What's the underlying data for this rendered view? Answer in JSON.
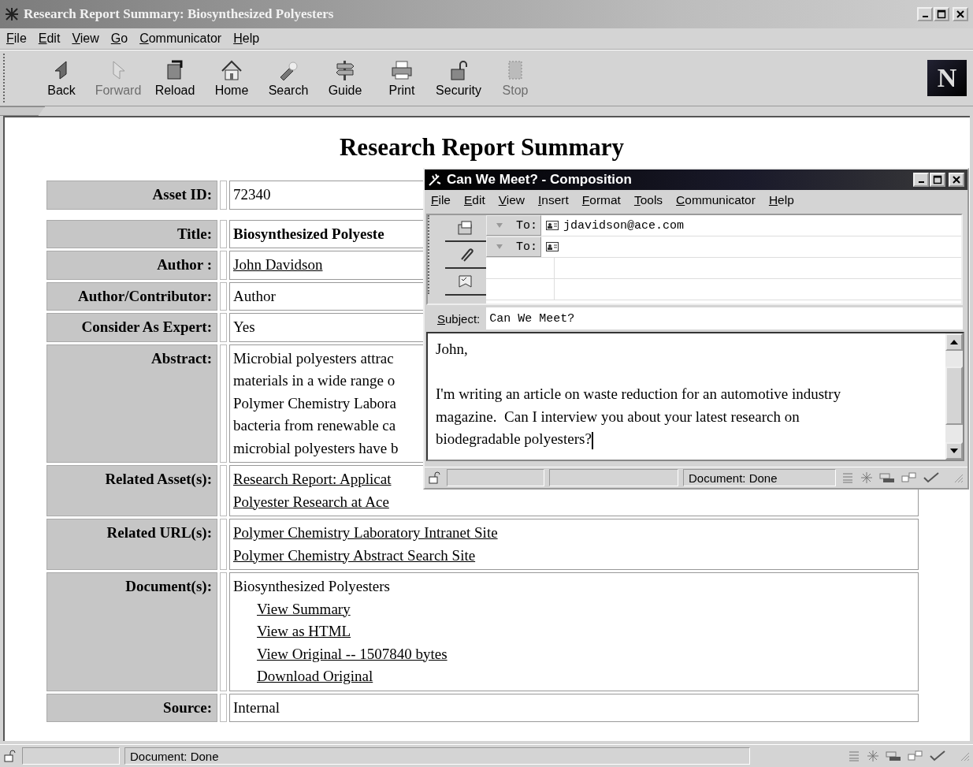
{
  "window": {
    "title": "Research Report Summary: Biosynthesized Polyesters"
  },
  "menu": [
    "File",
    "Edit",
    "View",
    "Go",
    "Communicator",
    "Help"
  ],
  "toolbar": [
    {
      "label": "Back",
      "disabled": false
    },
    {
      "label": "Forward",
      "disabled": true
    },
    {
      "label": "Reload",
      "disabled": false
    },
    {
      "label": "Home",
      "disabled": false
    },
    {
      "label": "Search",
      "disabled": false
    },
    {
      "label": "Guide",
      "disabled": false
    },
    {
      "label": "Print",
      "disabled": false
    },
    {
      "label": "Security",
      "disabled": false
    },
    {
      "label": "Stop",
      "disabled": true
    }
  ],
  "logo": "N",
  "page_title": "Research Report Summary",
  "fields": [
    {
      "label": "Asset ID:",
      "values": [
        {
          "kind": "text",
          "text": "72340"
        }
      ]
    },
    {
      "label": "Title:",
      "values": [
        {
          "kind": "bold",
          "text": "Biosynthesized Polyeste"
        }
      ]
    },
    {
      "label": "Author :",
      "values": [
        {
          "kind": "link",
          "text": "John Davidson"
        }
      ]
    },
    {
      "label": "Author/Contributor:",
      "values": [
        {
          "kind": "text",
          "text": "Author"
        }
      ]
    },
    {
      "label": "Consider As Expert:",
      "values": [
        {
          "kind": "text",
          "text": "Yes"
        }
      ]
    },
    {
      "label": "Abstract:",
      "values": [
        {
          "kind": "text",
          "text": "Microbial polyesters attrac"
        },
        {
          "kind": "text",
          "text": "materials in a wide range o"
        },
        {
          "kind": "text",
          "text": "Polymer Chemistry Labora"
        },
        {
          "kind": "text",
          "text": "bacteria from renewable ca"
        },
        {
          "kind": "text",
          "text": "microbial polyesters have b"
        }
      ]
    },
    {
      "label": "Related Asset(s):",
      "values": [
        {
          "kind": "link",
          "text": "Research Report: Applicat"
        },
        {
          "kind": "link",
          "text": "Polyester Research at Ace"
        }
      ]
    },
    {
      "label": "Related URL(s):",
      "values": [
        {
          "kind": "link",
          "text": "Polymer Chemistry Laboratory Intranet Site"
        },
        {
          "kind": "link",
          "text": "Polymer Chemistry Abstract Search Site"
        }
      ]
    },
    {
      "label": "Document(s):",
      "values": [
        {
          "kind": "text",
          "text": "Biosynthesized Polyesters"
        },
        {
          "kind": "sublink",
          "text": "View Summary"
        },
        {
          "kind": "sublink",
          "text": "View as HTML"
        },
        {
          "kind": "sublink",
          "text": "View Original -- 1507840 bytes"
        },
        {
          "kind": "sublink",
          "text": "Download Original"
        }
      ]
    },
    {
      "label": "Source:",
      "values": [
        {
          "kind": "text",
          "text": "Internal"
        }
      ]
    }
  ],
  "status_bar": {
    "text": "Document: Done"
  },
  "composition": {
    "title": "Can We Meet? - Composition",
    "menu": [
      "File",
      "Edit",
      "View",
      "Insert",
      "Format",
      "Tools",
      "Communicator",
      "Help"
    ],
    "recipients": [
      {
        "label": "To:",
        "address": "jdavidson@ace.com"
      },
      {
        "label": "To:"
      }
    ],
    "subject": {
      "label": "Subject:",
      "value": "Can We Meet?"
    },
    "body": [
      [
        "John,"
      ],
      [
        "I'm writing an article on waste reduction for an automotive industry",
        "magazine.  Can I interview you about your latest research on",
        "biodegradable polyesters?"
      ]
    ],
    "status": "Document: Done"
  }
}
